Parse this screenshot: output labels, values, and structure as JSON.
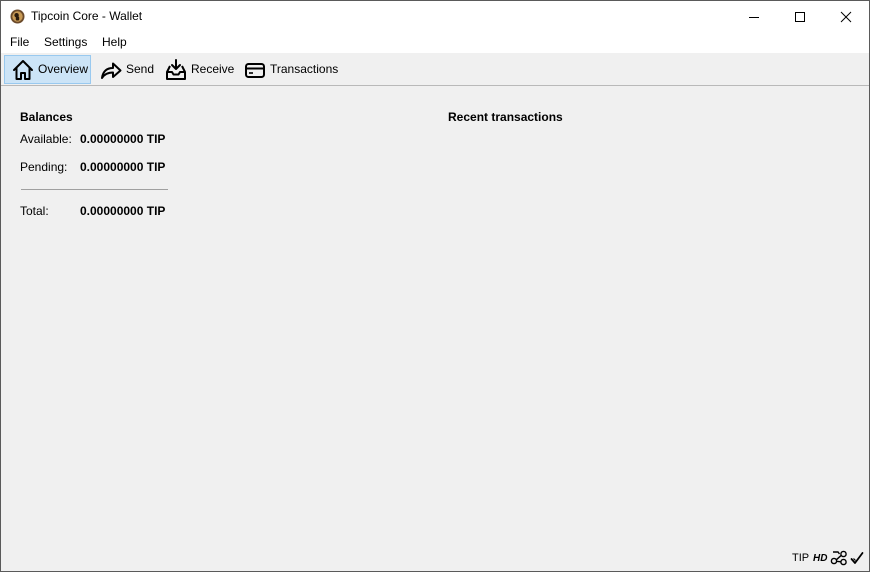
{
  "window": {
    "title": "Tipcoin Core - Wallet",
    "minimize_icon": "minimize-icon",
    "maximize_icon": "maximize-icon",
    "close_icon": "close-icon"
  },
  "menu": {
    "items": [
      "File",
      "Settings",
      "Help"
    ]
  },
  "toolbar": {
    "items": [
      {
        "label": "Overview",
        "icon": "home-icon",
        "active": true
      },
      {
        "label": "Send",
        "icon": "send-arrow-icon",
        "active": false
      },
      {
        "label": "Receive",
        "icon": "receive-inbox-icon",
        "active": false
      },
      {
        "label": "Transactions",
        "icon": "card-icon",
        "active": false
      }
    ]
  },
  "balances": {
    "title": "Balances",
    "available_label": "Available:",
    "available_value": "0.00000000 TIP",
    "pending_label": "Pending:",
    "pending_value": "0.00000000 TIP",
    "total_label": "Total:",
    "total_value": "0.00000000 TIP"
  },
  "recent": {
    "title": "Recent transactions"
  },
  "statusbar": {
    "unit": "TIP",
    "hd": "HD",
    "network_icon": "network-connections-icon",
    "sync_icon": "synced-check-icon"
  },
  "colors": {
    "active_tab_bg": "#cce4f7",
    "active_tab_border": "#99c9ef",
    "window_bg": "#f0f0f0"
  }
}
